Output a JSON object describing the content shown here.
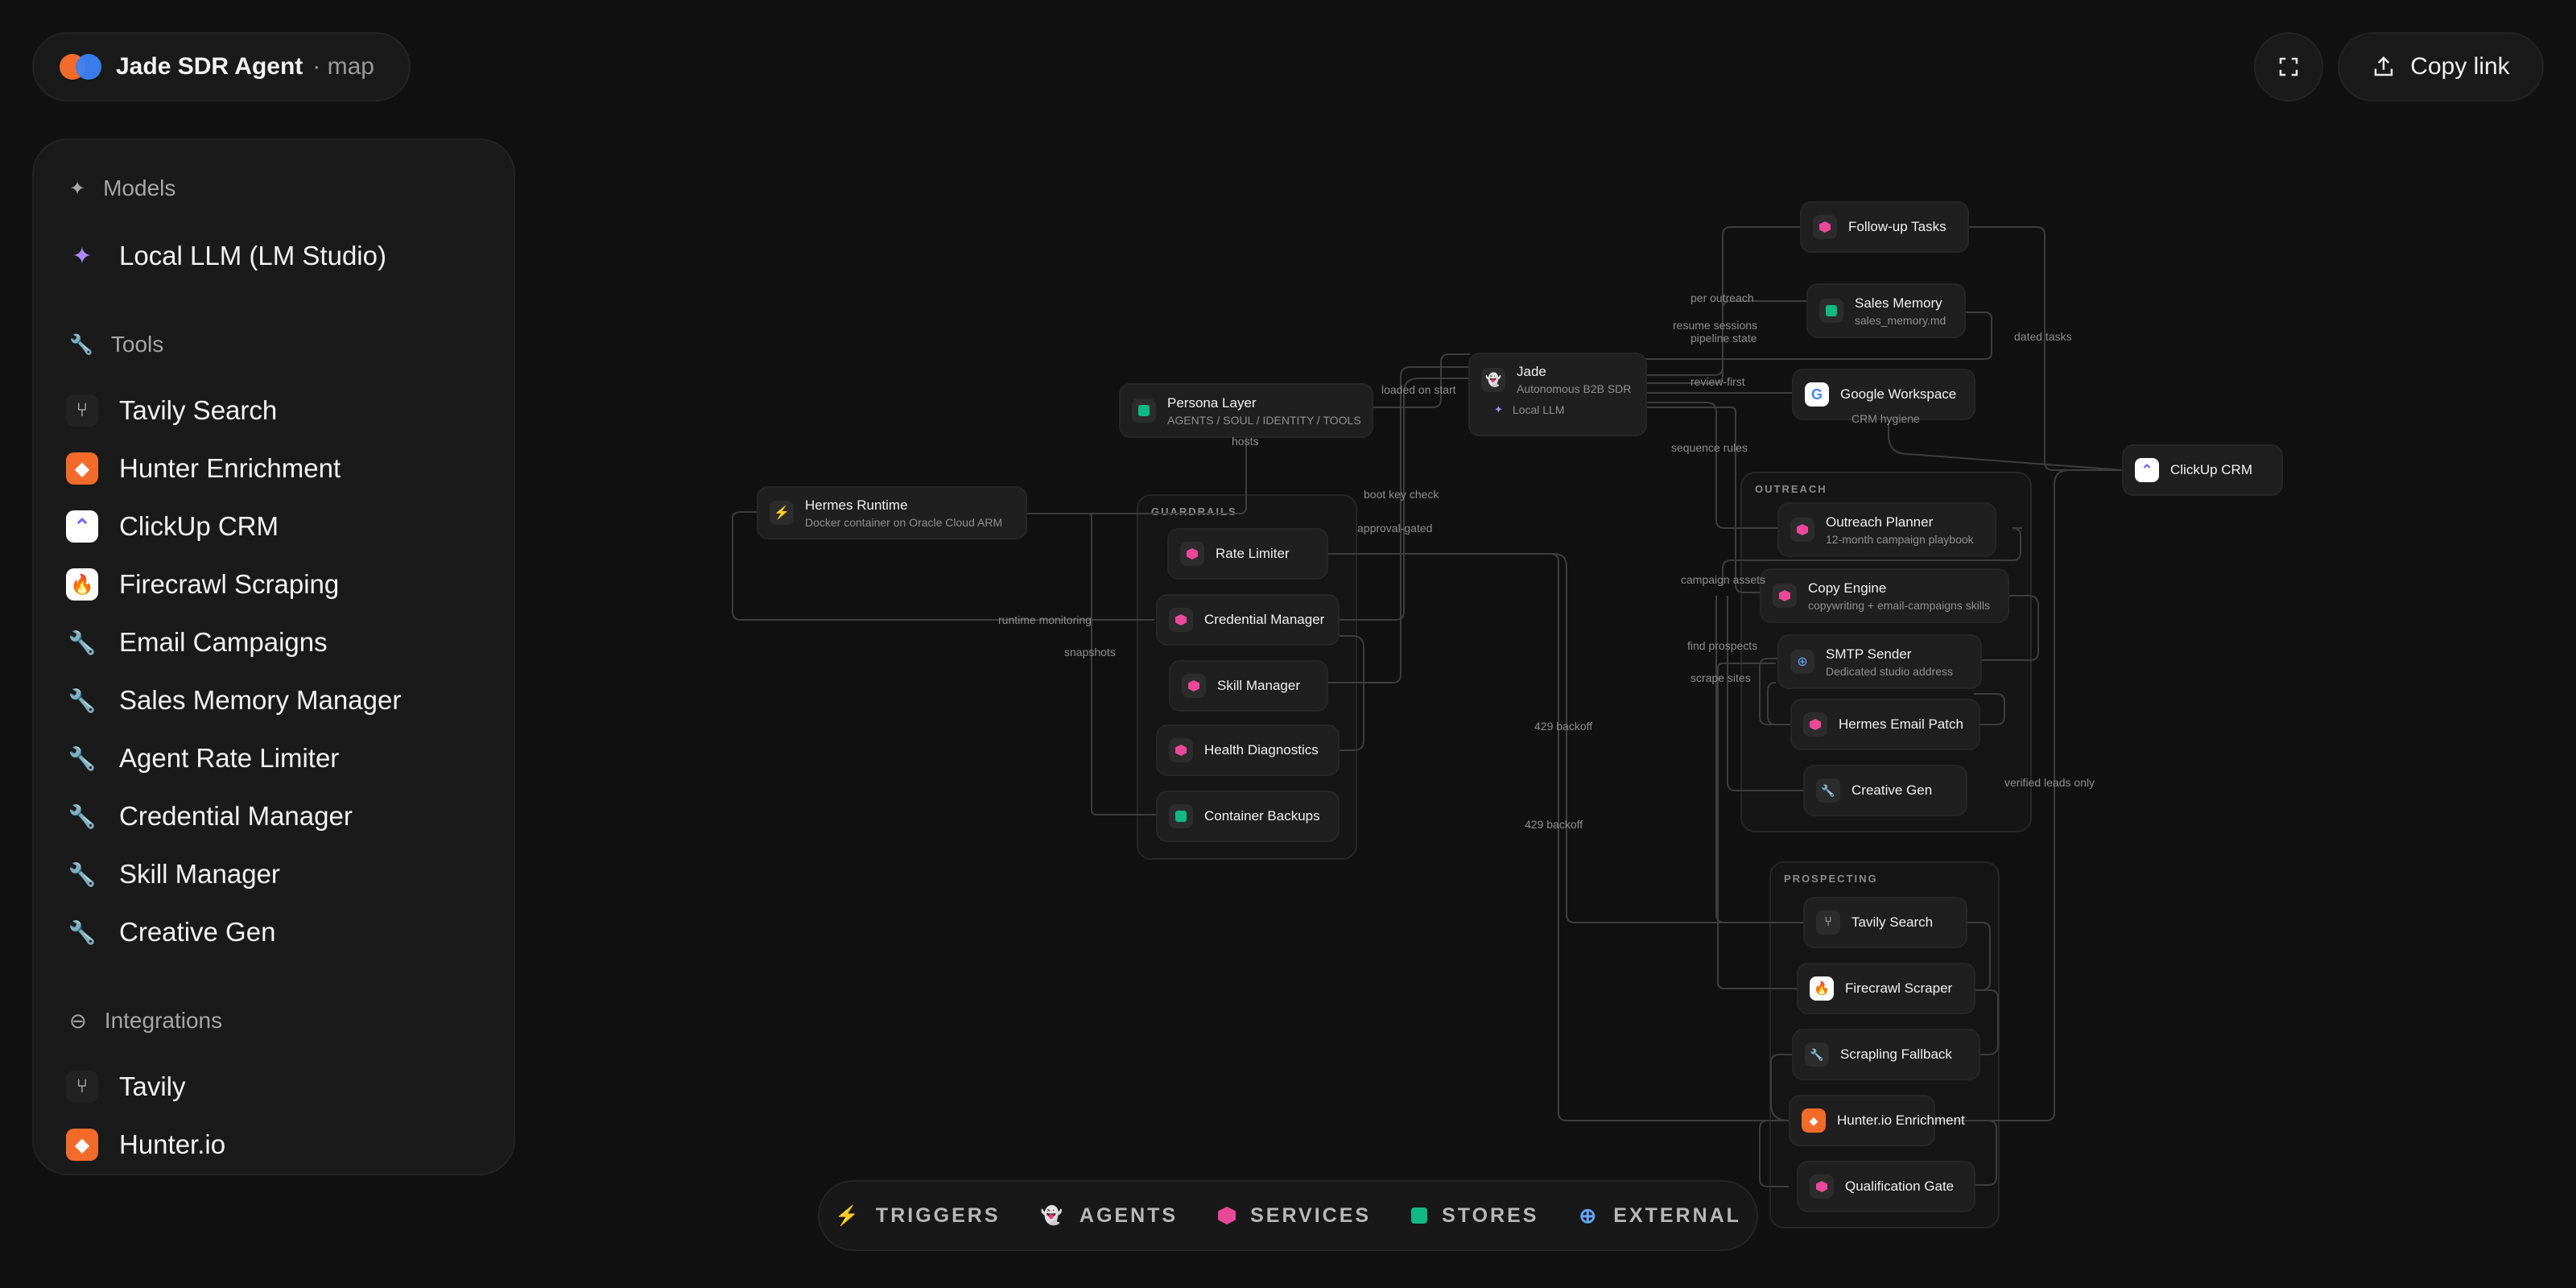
{
  "header": {
    "title": "Jade SDR Agent",
    "subtitle": "· map",
    "copy_label": "Copy link"
  },
  "sidebar": {
    "models_title": "Models",
    "models": [
      "Local LLM (LM Studio)"
    ],
    "tools_title": "Tools",
    "tools": [
      "Tavily Search",
      "Hunter Enrichment",
      "ClickUp CRM",
      "Firecrawl Scraping",
      "Email Campaigns",
      "Sales Memory Manager",
      "Agent Rate Limiter",
      "Credential Manager",
      "Skill Manager",
      "Creative Gen"
    ],
    "integrations_title": "Integrations",
    "integrations": [
      "Tavily",
      "Hunter.io"
    ]
  },
  "groups": {
    "guardrails": "GUARDRAILS",
    "outreach": "OUTREACH",
    "prospecting": "PROSPECTING"
  },
  "nodes": {
    "hermes_runtime": {
      "title": "Hermes Runtime",
      "sub": "Docker container on Oracle Cloud ARM"
    },
    "persona_layer": {
      "title": "Persona Layer",
      "sub": "AGENTS / SOUL / IDENTITY / TOOLS"
    },
    "jade": {
      "title": "Jade",
      "sub": "Autonomous B2B SDR",
      "sub2": "Local LLM"
    },
    "rate_limiter": {
      "title": "Rate Limiter"
    },
    "credential_manager": {
      "title": "Credential Manager"
    },
    "skill_manager": {
      "title": "Skill Manager"
    },
    "health_diagnostics": {
      "title": "Health Diagnostics"
    },
    "container_backups": {
      "title": "Container Backups"
    },
    "followup_tasks": {
      "title": "Follow-up Tasks"
    },
    "sales_memory": {
      "title": "Sales Memory",
      "sub": "sales_memory.md"
    },
    "google_workspace": {
      "title": "Google Workspace"
    },
    "clickup_crm": {
      "title": "ClickUp CRM"
    },
    "outreach_planner": {
      "title": "Outreach Planner",
      "sub": "12-month campaign playbook"
    },
    "copy_engine": {
      "title": "Copy Engine",
      "sub": "copywriting + email-campaigns skills"
    },
    "smtp_sender": {
      "title": "SMTP Sender",
      "sub": "Dedicated studio address"
    },
    "hermes_email_patch": {
      "title": "Hermes Email Patch"
    },
    "creative_gen": {
      "title": "Creative Gen"
    },
    "tavily_search": {
      "title": "Tavily Search"
    },
    "firecrawl_scraper": {
      "title": "Firecrawl Scraper"
    },
    "scrapling_fallback": {
      "title": "Scrapling Fallback"
    },
    "hunter_enrichment": {
      "title": "Hunter.io Enrichment"
    },
    "qualification_gate": {
      "title": "Qualification Gate"
    }
  },
  "edge_labels": {
    "hosts": "hosts",
    "loaded_on_start": "loaded on start",
    "boot_key_check": "boot key check",
    "approval_gated": "approval-gated",
    "runtime_monitoring": "runtime monitoring",
    "snapshots": "snapshots",
    "per_outreach": "per outreach",
    "resume_sessions": "resume sessions",
    "pipeline_state": "pipeline state",
    "dated_tasks": "dated tasks",
    "review_first": "review-first",
    "crm_hygiene": "CRM hygiene",
    "sequence_rules": "sequence rules",
    "campaign_assets": "campaign assets",
    "find_prospects": "find prospects",
    "scrape_sites": "scrape sites",
    "backoff_1": "429 backoff",
    "backoff_2": "429 backoff",
    "verified_leads_only": "verified leads only"
  },
  "legend": [
    "TRIGGERS",
    "AGENTS",
    "SERVICES",
    "STORES",
    "EXTERNAL"
  ],
  "colors": {
    "service": "#ec4899",
    "store": "#10b981",
    "agent": "#f59e0b",
    "external": "#3b82f6",
    "model": "#a78bfa"
  }
}
